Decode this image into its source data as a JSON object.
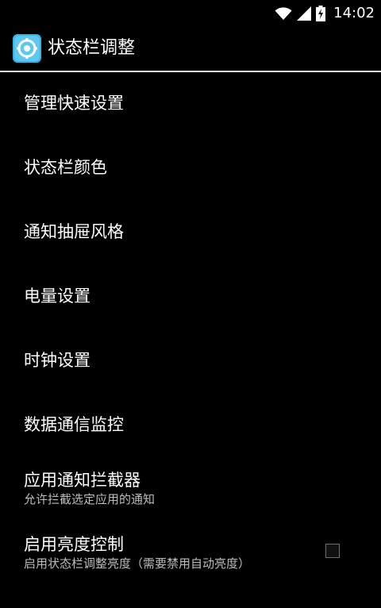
{
  "status_bar": {
    "time": "14:02",
    "icons": [
      "wifi-icon",
      "signal-icon",
      "battery-charging-icon"
    ]
  },
  "action_bar": {
    "title": "状态栏调整",
    "icon": "gear-icon"
  },
  "list": {
    "items": [
      {
        "title": "管理快速设置",
        "summary": ""
      },
      {
        "title": "状态栏颜色",
        "summary": ""
      },
      {
        "title": "通知抽屉风格",
        "summary": ""
      },
      {
        "title": "电量设置",
        "summary": ""
      },
      {
        "title": "时钟设置",
        "summary": ""
      },
      {
        "title": "数据通信监控",
        "summary": ""
      },
      {
        "title": "应用通知拦截器",
        "summary": "允许拦截选定应用的通知"
      },
      {
        "title": "启用亮度控制",
        "summary": "启用状态栏调整亮度（需要禁用自动亮度）",
        "checked": false
      }
    ]
  },
  "colors": {
    "background": "#000000",
    "divider": "#e6e6e6",
    "icon_blue": "#33b5e5",
    "summary_text": "#bdbdbd"
  }
}
